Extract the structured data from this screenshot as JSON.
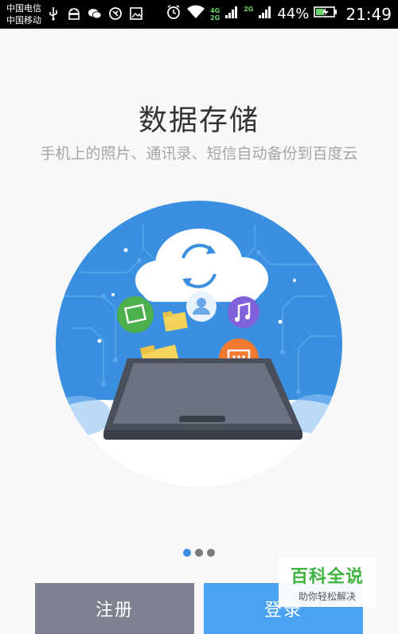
{
  "status_bar": {
    "carrier_1": "中国电信",
    "carrier_2": "中国移动",
    "net_top": "4G",
    "net_bottom": "2G",
    "net_2": "2G",
    "battery": "44%",
    "time": "21:49",
    "icons": [
      "usb-icon",
      "android-icon",
      "wechat-icon",
      "app-icon",
      "image-icon",
      "alarm-icon",
      "wifi-icon",
      "signal-icon",
      "battery-charging-icon"
    ]
  },
  "intro": {
    "title": "数据存储",
    "subtitle": "手机上的照片、通讯录、短信自动备份到百度云"
  },
  "pager": {
    "pages": 3,
    "active": 0
  },
  "buttons": {
    "register": "注册",
    "login": "登录"
  },
  "watermark": {
    "title": "百科全说",
    "subtitle": "助你轻松解决"
  },
  "colors": {
    "circle_blue": "#3b8fe0",
    "login_blue": "#4aa3f2",
    "register_gray": "#7d8190",
    "green": "#3fb33f"
  }
}
